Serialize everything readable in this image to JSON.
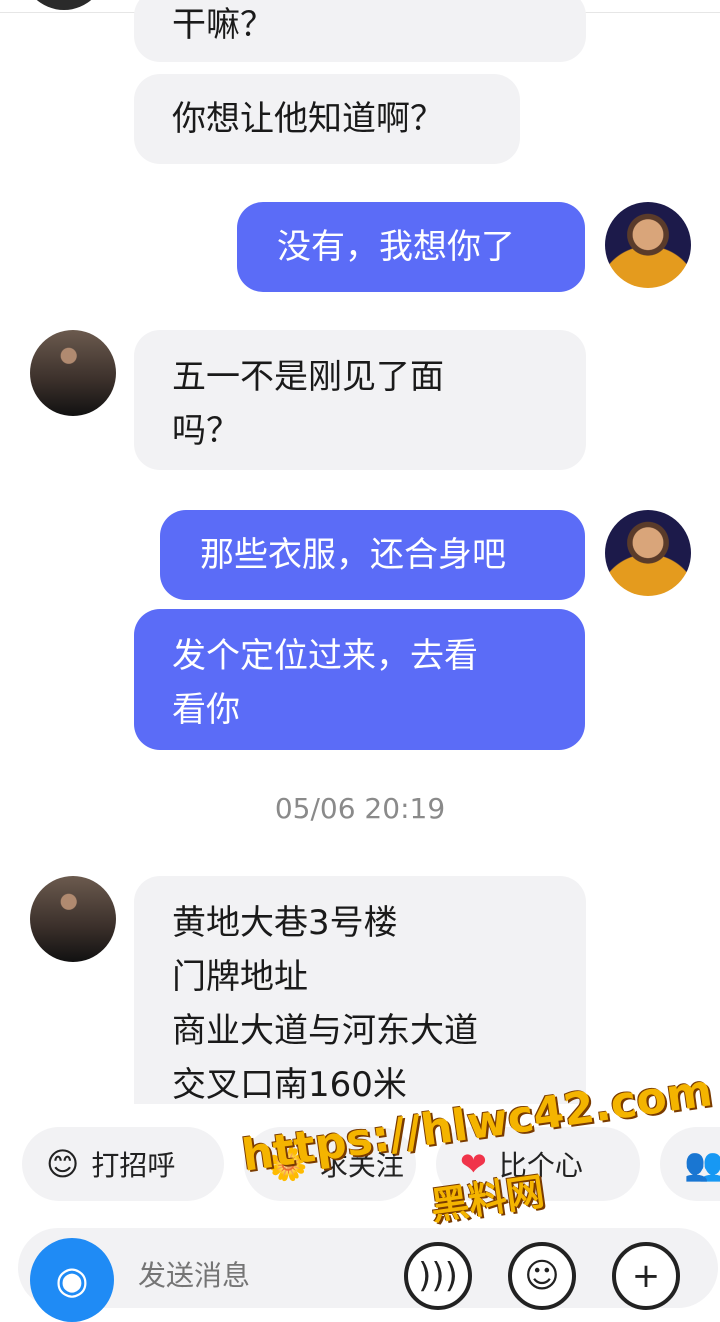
{
  "messages": [
    {
      "side": "in",
      "text": "干嘛？"
    },
    {
      "side": "in",
      "text": "你想让他知道啊？"
    },
    {
      "side": "out",
      "text": "没有，我想你了"
    },
    {
      "side": "in",
      "lines": [
        "五一不是刚见了面",
        "吗？"
      ]
    },
    {
      "side": "out",
      "text": "那些衣服，还合身吧"
    },
    {
      "side": "out",
      "lines": [
        "发个定位过来，去看",
        "看你"
      ]
    },
    {
      "side": "in",
      "lines": [
        "黄地大巷3号楼",
        "门牌地址",
        "商业大道与河东大道",
        "交叉口南160米"
      ]
    }
  ],
  "timestamp": "05/06 20:19",
  "quick_replies": [
    {
      "icon": "smile-emoji-icon",
      "label": "打招呼"
    },
    {
      "icon": "flower-icon",
      "label": "求关注"
    },
    {
      "icon": "heart-icon",
      "label": "比个心"
    },
    {
      "icon": "people-icon",
      "label": ""
    }
  ],
  "input": {
    "placeholder": "发送消息"
  },
  "watermark": {
    "line1": "https://hlwc42.com",
    "line2": "黑料网"
  },
  "colors": {
    "outgoing_bubble": "#5b6cf7",
    "incoming_bubble": "#f2f2f4",
    "camera_button": "#1f8bf5"
  }
}
